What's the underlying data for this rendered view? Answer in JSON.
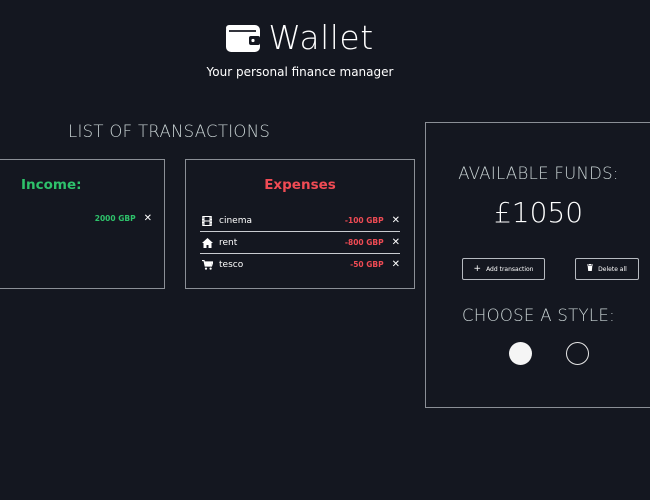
{
  "header": {
    "title": "Wallet",
    "subtitle": "Your personal finance manager",
    "icon": "wallet-icon"
  },
  "transactions": {
    "title": "LIST OF TRANSACTIONS",
    "income": {
      "heading": "Income:",
      "items": [
        {
          "amount": "2000 GBP",
          "delete": "✕"
        }
      ]
    },
    "expenses": {
      "heading": "Expenses",
      "items": [
        {
          "icon": "film-icon",
          "label": "cinema",
          "amount": "-100 GBP",
          "delete": "✕"
        },
        {
          "icon": "home-icon",
          "label": "rent",
          "amount": "-800 GBP",
          "delete": "✕"
        },
        {
          "icon": "cart-icon",
          "label": "tesco",
          "amount": "-50 GBP",
          "delete": "✕"
        }
      ]
    }
  },
  "funds": {
    "title": "AVAILABLE FUNDS:",
    "value": "£1050",
    "add_label": "Add transaction",
    "delete_label": "Delete all",
    "style_title": "CHOOSE A STYLE:",
    "styles": [
      "light",
      "dark"
    ]
  },
  "colors": {
    "background": "#141720",
    "income": "#2ec26b",
    "expense": "#f04b54",
    "border": "#8b8f96"
  }
}
